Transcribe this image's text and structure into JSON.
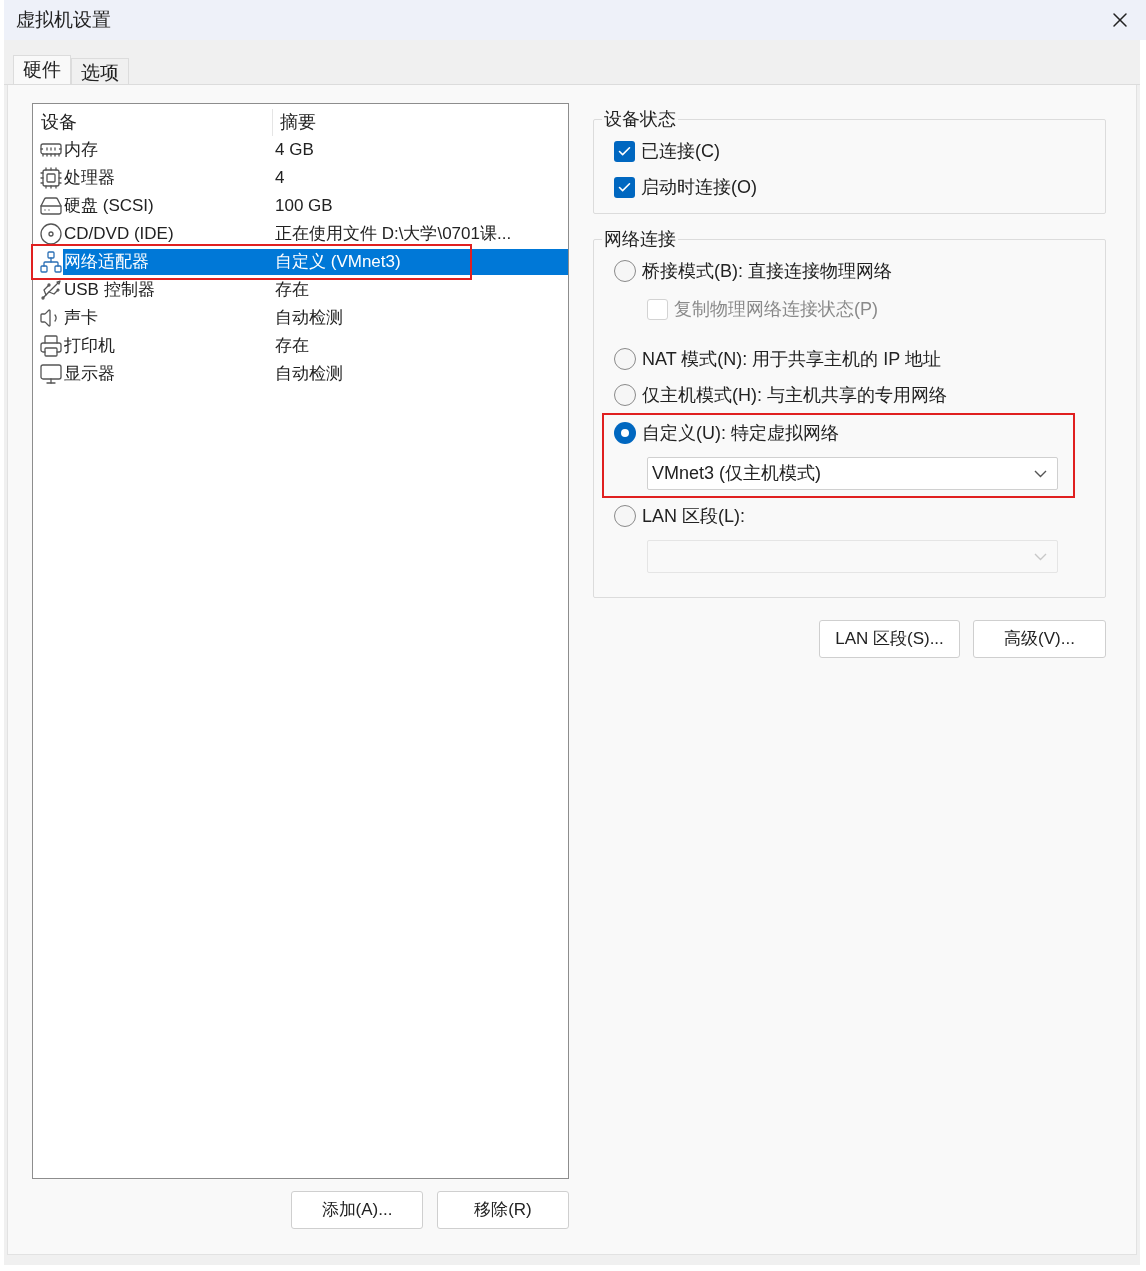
{
  "window": {
    "title": "虚拟机设置"
  },
  "tabs": [
    {
      "label": "硬件",
      "selected": true
    },
    {
      "label": "选项",
      "selected": false
    }
  ],
  "device_table": {
    "columns": [
      "设备",
      "摘要"
    ],
    "rows": [
      {
        "kind": "memory",
        "device": "内存",
        "summary": "4 GB",
        "selected": false
      },
      {
        "kind": "cpu",
        "device": "处理器",
        "summary": "4",
        "selected": false
      },
      {
        "kind": "disk",
        "device": "硬盘 (SCSI)",
        "summary": "100 GB",
        "selected": false
      },
      {
        "kind": "cd",
        "device": "CD/DVD (IDE)",
        "summary": "正在使用文件 D:\\大学\\0701课...",
        "selected": false
      },
      {
        "kind": "network",
        "device": "网络适配器",
        "summary": "自定义 (VMnet3)",
        "selected": true,
        "highlighted": true
      },
      {
        "kind": "usb",
        "device": "USB 控制器",
        "summary": "存在",
        "selected": false
      },
      {
        "kind": "sound",
        "device": "声卡",
        "summary": "自动检测",
        "selected": false
      },
      {
        "kind": "printer",
        "device": "打印机",
        "summary": "存在",
        "selected": false
      },
      {
        "kind": "display",
        "device": "显示器",
        "summary": "自动检测",
        "selected": false
      }
    ]
  },
  "list_buttons": [
    "添加(A)...",
    "移除(R)"
  ],
  "device_status": {
    "title": "设备状态",
    "checkboxes": [
      {
        "label": "已连接(C)",
        "checked": true
      },
      {
        "label": "启动时连接(O)",
        "checked": true
      }
    ]
  },
  "network_connection": {
    "title": "网络连接",
    "options": [
      {
        "label": "桥接模式(B): 直接连接物理网络",
        "selected": false,
        "sub_checkbox": {
          "label": "复制物理网络连接状态(P)",
          "checked": false,
          "disabled": true
        }
      },
      {
        "label": "NAT 模式(N): 用于共享主机的 IP 地址",
        "selected": false
      },
      {
        "label": "仅主机模式(H): 与主机共享的专用网络",
        "selected": false
      },
      {
        "label": "自定义(U): 特定虚拟网络",
        "selected": true,
        "highlighted": true,
        "dropdown": {
          "value": "VMnet3 (仅主机模式)",
          "disabled": false
        }
      },
      {
        "label": "LAN 区段(L):",
        "selected": false,
        "dropdown": {
          "disabled": true
        }
      }
    ]
  },
  "network_buttons": [
    "LAN 区段(S)...",
    "高级(V)..."
  ]
}
